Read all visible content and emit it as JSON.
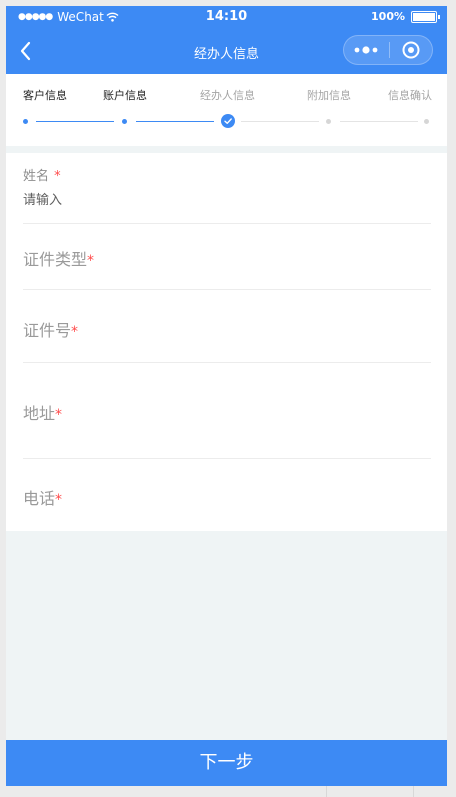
{
  "status_bar": {
    "carrier": "WeChat",
    "time": "14:10",
    "battery": "100%",
    "battery_level": 1.0
  },
  "nav": {
    "title": "经办人信息",
    "back_icon": "chevron-left-icon",
    "more_icon": "more-dots-icon",
    "close_icon": "target-close-icon"
  },
  "steps": [
    {
      "label": "客户信息",
      "state": "done"
    },
    {
      "label": "账户信息",
      "state": "done"
    },
    {
      "label": "经办人信息",
      "state": "current"
    },
    {
      "label": "附加信息",
      "state": "todo"
    },
    {
      "label": "信息确认",
      "state": "todo"
    }
  ],
  "form": {
    "name": {
      "label": "姓名",
      "required_mark": "*",
      "placeholder": "请输入",
      "value": ""
    },
    "id_type": {
      "label": "证件类型",
      "required_mark": "*"
    },
    "id_number": {
      "label": "证件号",
      "required_mark": "*"
    },
    "address": {
      "label": "地址",
      "required_mark": "*"
    },
    "phone": {
      "label": "电话",
      "required_mark": "*"
    }
  },
  "footer": {
    "next_label": "下一步"
  },
  "colors": {
    "primary": "#3d8af4",
    "required": "#ff4b4b",
    "inactive": "#d6d6d6",
    "background": "#eff4f5"
  }
}
